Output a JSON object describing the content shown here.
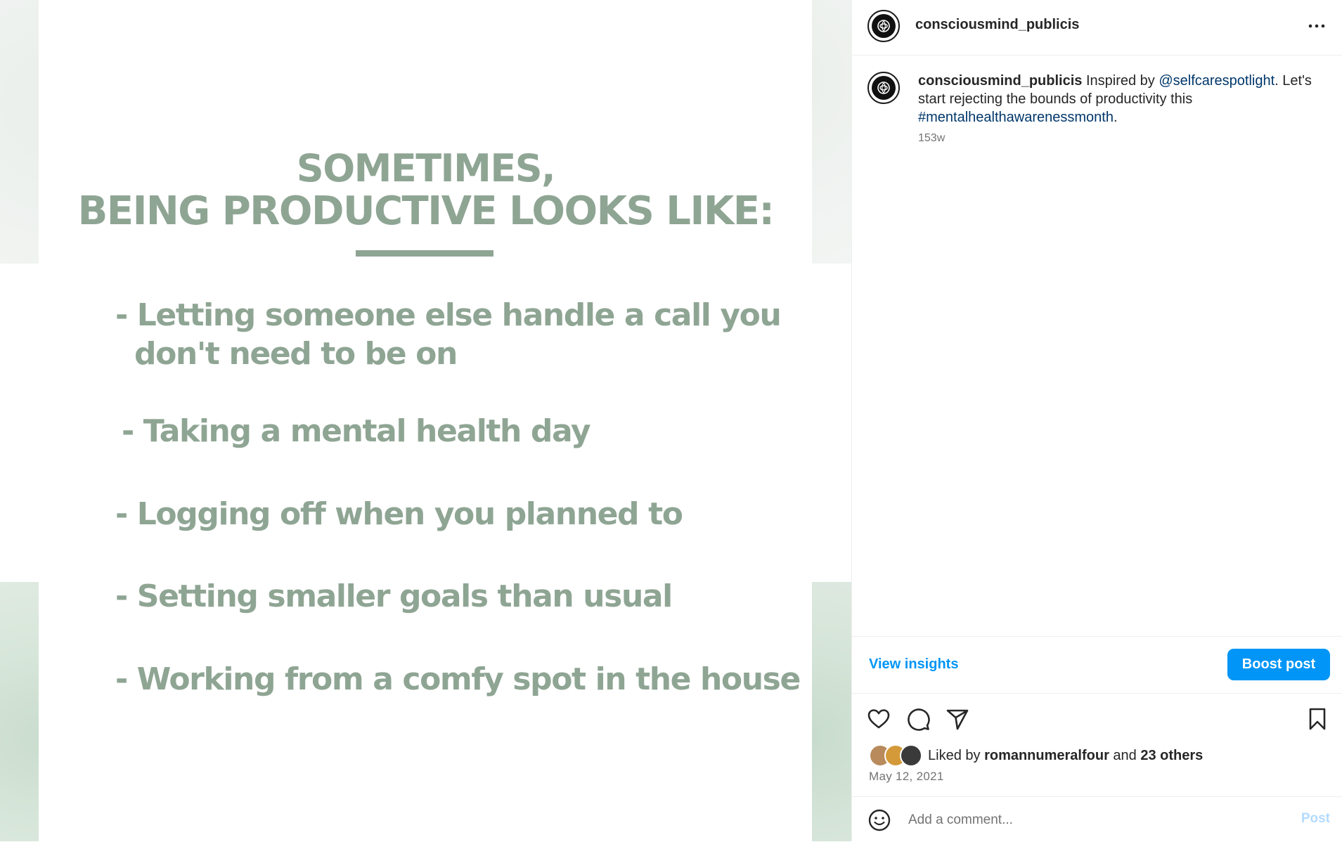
{
  "post": {
    "slide": {
      "title_line_1": "SOMETIMES,",
      "title_line_2": "BEING PRODUCTIVE LOOKS LIKE:",
      "bullets": [
        {
          "line_1": "- Letting someone else handle a call you",
          "line_2": "don't need to be on"
        },
        {
          "line_1": "- Taking a mental health day"
        },
        {
          "line_1": "- Logging off when you planned to"
        },
        {
          "line_1": "- Setting smaller goals than usual"
        },
        {
          "line_1": "- Working from a comfy spot in the house"
        }
      ],
      "text_color": "#8fa594"
    }
  },
  "header": {
    "username": "consciousmind_publicis",
    "more_icon": "more-horizontal-icon"
  },
  "caption": {
    "username": "consciousmind_publicis",
    "text_1": " Inspired by ",
    "mention": "@selfcarespotlight",
    "text_2": ". Let's start rejecting the bounds of productivity this ",
    "hashtag": "#mentalhealthawarenessmonth",
    "text_3": ".",
    "time": "153w"
  },
  "insights": {
    "view_label": "View insights",
    "boost_label": "Boost post",
    "accent": "#0095f6"
  },
  "actions": {
    "icons": [
      "heart-icon",
      "comment-icon",
      "share-icon",
      "bookmark-icon"
    ]
  },
  "likes": {
    "prefix": "Liked by ",
    "user": "romannumeralfour",
    "middle": " and ",
    "others": "23 others"
  },
  "date": "May 12, 2021",
  "comment": {
    "placeholder": "Add a comment...",
    "post_label": "Post"
  }
}
